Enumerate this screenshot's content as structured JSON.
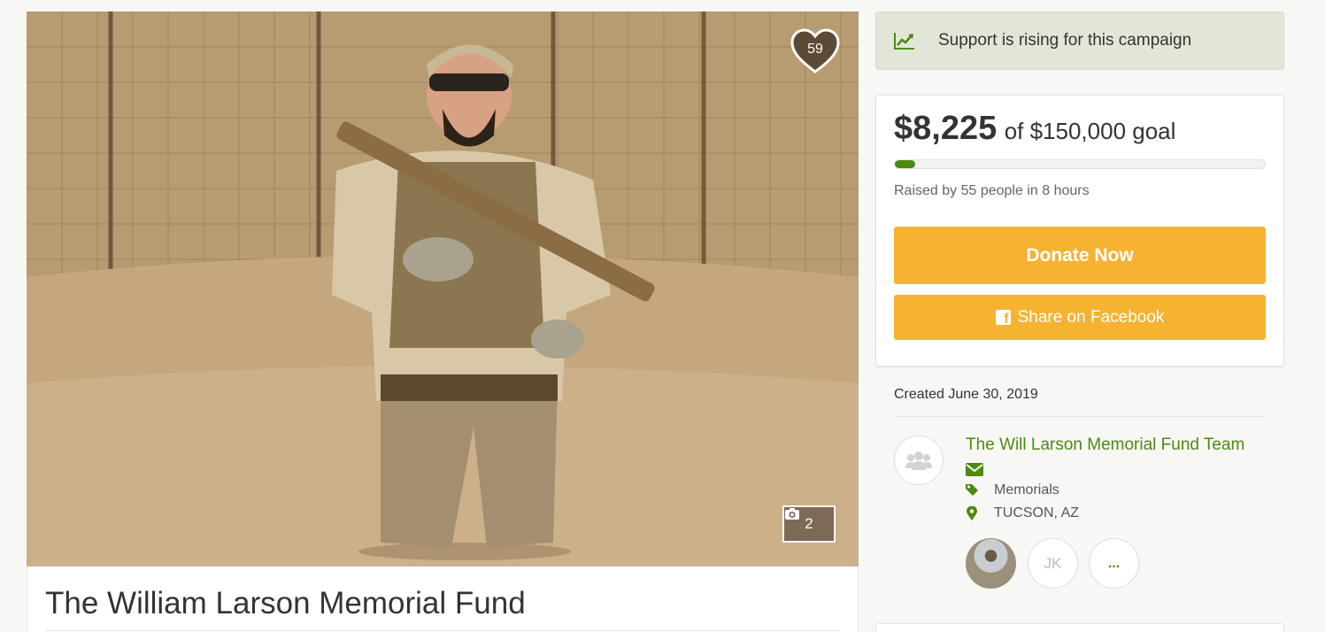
{
  "campaign": {
    "title": "The William Larson Memorial Fund",
    "hearts": "59",
    "photo_count": "2"
  },
  "momentum": {
    "text": "Support is rising for this campaign",
    "icon": "trending-up-icon"
  },
  "funding": {
    "raised": "$8,225",
    "goal_text": "of $150,000 goal",
    "progress_fraction": 0.055,
    "raised_by": "Raised by 55 people in 8 hours"
  },
  "actions": {
    "donate_label": "Donate Now",
    "share_label": "Share on Facebook"
  },
  "details": {
    "created": "Created June 30, 2019",
    "organizer": "The Will Larson Memorial Fund Team",
    "category": "Memorials",
    "location": "TUCSON, AZ"
  },
  "helpers": [
    {
      "initials": ""
    },
    {
      "initials": "JK"
    },
    {
      "initials": "..."
    }
  ],
  "colors": {
    "accent_green": "#4c8a0f",
    "button_yellow": "#f6b231",
    "banner_bg": "#e2e6d9"
  }
}
